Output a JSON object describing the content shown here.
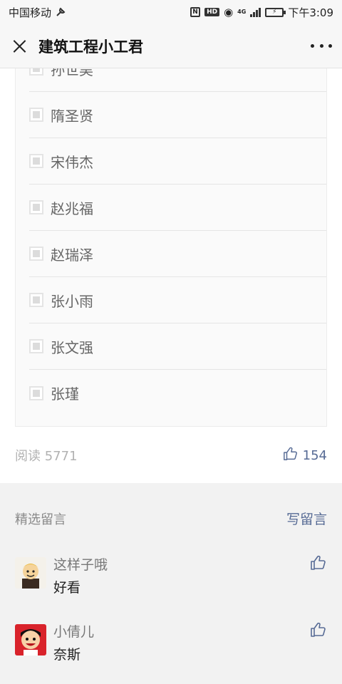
{
  "status_bar": {
    "carrier": "中国移动",
    "network": "4G",
    "time": "下午3:09"
  },
  "nav": {
    "title": "建筑工程小工君"
  },
  "names": [
    "孙世昊",
    "隋圣贤",
    "宋伟杰",
    "赵兆福",
    "赵瑞泽",
    "张小雨",
    "张文强",
    "张瑾"
  ],
  "stats": {
    "read_label": "阅读 5771",
    "like_count": "154"
  },
  "comments_section": {
    "title": "精选留言",
    "write_label": "写留言",
    "items": [
      {
        "nickname": "这样子哦",
        "text": "好看"
      },
      {
        "nickname": "小倩儿",
        "text": "奈斯"
      }
    ]
  },
  "colors": {
    "link": "#576b95",
    "muted": "#b2b2b2",
    "section_bg": "#f2f2f2"
  }
}
